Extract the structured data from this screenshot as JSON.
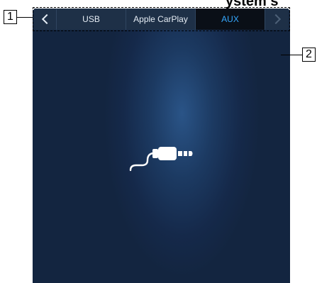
{
  "header": {
    "partial_text": "ystem s"
  },
  "callouts": {
    "one": "1",
    "two": "2"
  },
  "tabs": {
    "prev_icon": "chevron-left-icon",
    "items": [
      {
        "label": "USB"
      },
      {
        "label": "Apple CarPlay"
      },
      {
        "label": "AUX"
      }
    ],
    "selected": "AUX",
    "next_icon": "chevron-right-icon"
  },
  "controls": {
    "equalizer_icon": "sound-settings-icon"
  },
  "main": {
    "source_icon": "aux-cable-plug-icon"
  },
  "colors": {
    "background": "#15294a",
    "tab_bar": "#1e3047",
    "tab_selected_bg": "#0a0f17",
    "tab_selected_text": "#35a8ff",
    "icon": "#ffffff"
  }
}
